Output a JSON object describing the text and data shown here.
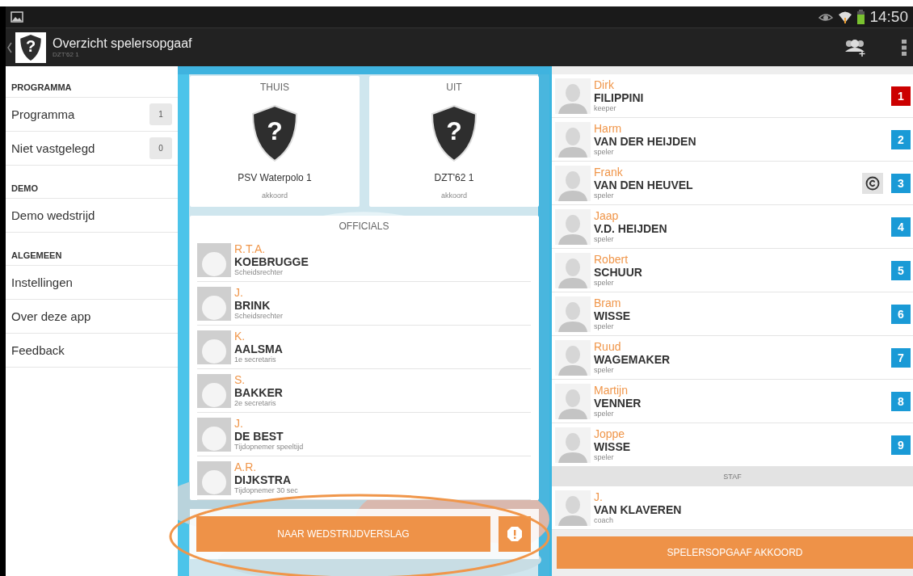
{
  "status_bar": {
    "time": "14:50"
  },
  "app_bar": {
    "logo_mark": "?",
    "title": "Overzicht spelersopgaaf",
    "subtitle": "DZT'62 1"
  },
  "sidebar": {
    "sections": [
      {
        "header": "PROGRAMMA",
        "items": [
          {
            "label": "Programma",
            "count": "1"
          },
          {
            "label": "Niet vastgelegd",
            "count": "0"
          }
        ]
      },
      {
        "header": "DEMO",
        "items": [
          {
            "label": "Demo wedstrijd"
          }
        ]
      },
      {
        "header": "ALGEMEEN",
        "items": [
          {
            "label": "Instellingen"
          },
          {
            "label": "Over deze app"
          },
          {
            "label": "Feedback"
          }
        ]
      }
    ]
  },
  "teams": [
    {
      "side": "THUIS",
      "crest_mark": "?",
      "name": "PSV Waterpolo 1",
      "status": "akkoord"
    },
    {
      "side": "UIT",
      "crest_mark": "?",
      "name": "DZT'62 1",
      "status": "akkoord"
    }
  ],
  "officials": {
    "title": "OFFICIALS",
    "rows": [
      {
        "initials": "R.T.A.",
        "surname": "KOEBRUGGE",
        "role": "Scheidsrechter"
      },
      {
        "initials": "J.",
        "surname": "BRINK",
        "role": "Scheidsrechter"
      },
      {
        "initials": "K.",
        "surname": "AALSMA",
        "role": "1e secretaris"
      },
      {
        "initials": "S.",
        "surname": "BAKKER",
        "role": "2e secretaris"
      },
      {
        "initials": "J.",
        "surname": "DE BEST",
        "role": "Tijdopnemer speeltijd"
      },
      {
        "initials": "A.R.",
        "surname": "DIJKSTRA",
        "role": "Tijdopnemer 30 sec"
      }
    ]
  },
  "report_button": "NAAR WEDSTRIJDVERSLAG",
  "players": [
    {
      "first": "Dirk",
      "surname": "FILIPPINI",
      "role": "keeper",
      "number": "1",
      "color": "#cc0000",
      "captain": false
    },
    {
      "first": "Harm",
      "surname": "VAN DER HEIJDEN",
      "role": "speler",
      "number": "2",
      "color": "#1a9ad6",
      "captain": false
    },
    {
      "first": "Frank",
      "surname": "VAN DEN HEUVEL",
      "role": "speler",
      "number": "3",
      "color": "#1a9ad6",
      "captain": true
    },
    {
      "first": "Jaap",
      "surname": "V.D. HEIJDEN",
      "role": "speler",
      "number": "4",
      "color": "#1a9ad6",
      "captain": false
    },
    {
      "first": "Robert",
      "surname": "SCHUUR",
      "role": "speler",
      "number": "5",
      "color": "#1a9ad6",
      "captain": false
    },
    {
      "first": "Bram",
      "surname": "WISSE",
      "role": "speler",
      "number": "6",
      "color": "#1a9ad6",
      "captain": false
    },
    {
      "first": "Ruud",
      "surname": "WAGEMAKER",
      "role": "speler",
      "number": "7",
      "color": "#1a9ad6",
      "captain": false
    },
    {
      "first": "Martijn",
      "surname": "VENNER",
      "role": "speler",
      "number": "8",
      "color": "#1a9ad6",
      "captain": false
    },
    {
      "first": "Joppe",
      "surname": "WISSE",
      "role": "speler",
      "number": "9",
      "color": "#1a9ad6",
      "captain": false
    }
  ],
  "staff": {
    "title": "STAF",
    "rows": [
      {
        "first": "J.",
        "surname": "VAN KLAVEREN",
        "role": "coach"
      }
    ]
  },
  "approve_button": "SPELERSOPGAAF AKKOORD"
}
